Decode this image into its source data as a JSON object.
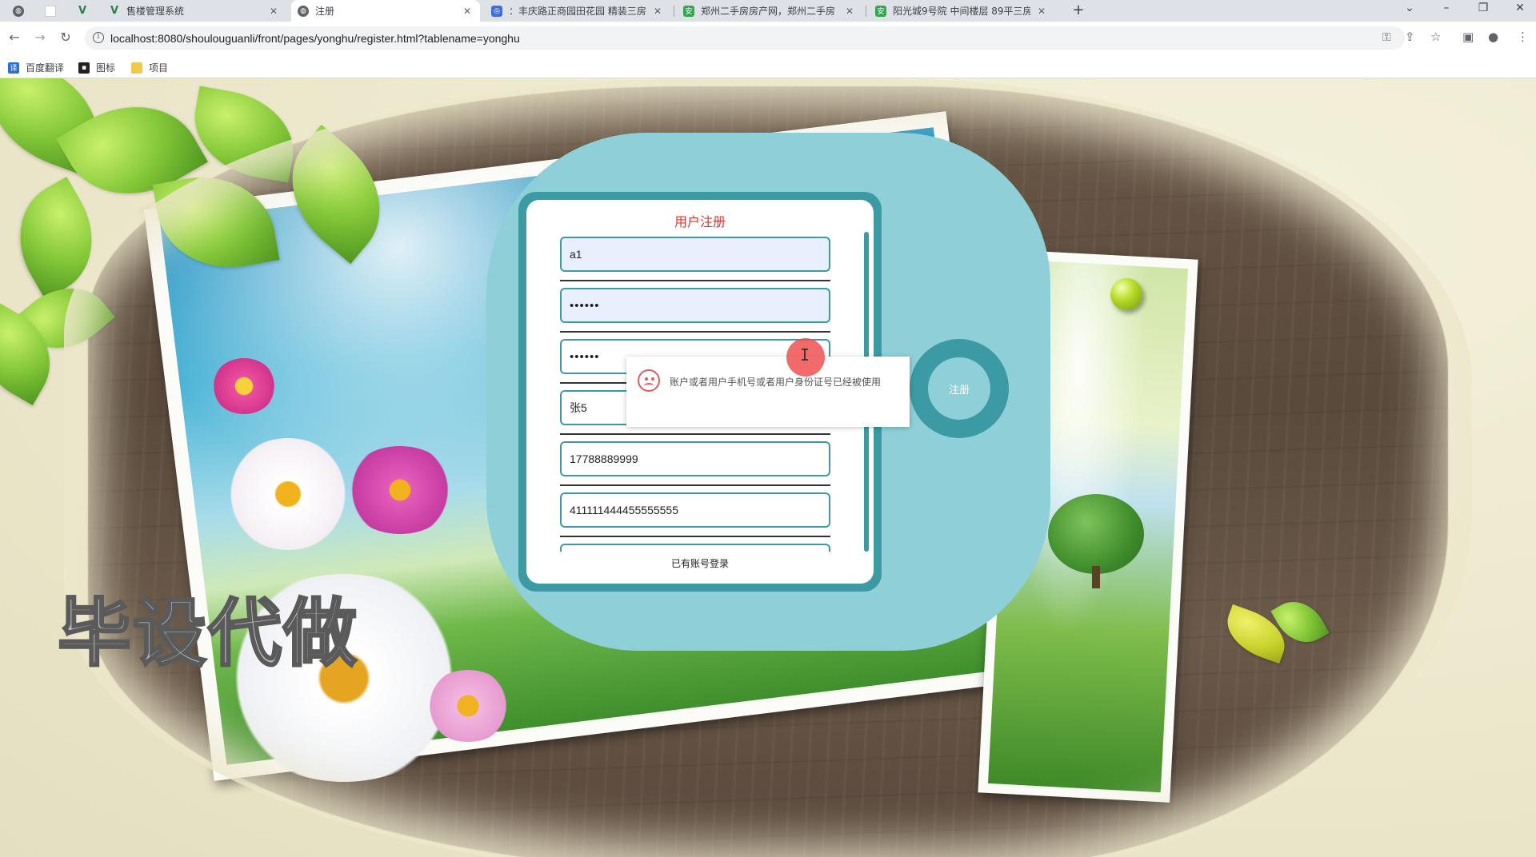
{
  "browser": {
    "tabs": [
      {
        "title": "",
        "icon": "globe-icon"
      },
      {
        "title": "",
        "icon": "blank-page-icon"
      },
      {
        "title": "",
        "icon": "vue-icon"
      },
      {
        "title": "售楼管理系统",
        "icon": "vue-icon"
      },
      {
        "title": "注册",
        "icon": "globe-icon",
        "active": true
      },
      {
        "title": "：丰庆路正商园田花园 精装三房",
        "icon": "baidu-icon"
      },
      {
        "title": "郑州二手房房产网，郑州二手房",
        "icon": "anjuke-icon"
      },
      {
        "title": "阳光城9号院 中间楼层 89平三房",
        "icon": "anjuke-icon"
      }
    ],
    "new_tab": "+",
    "url": "localhost:8080/shoulouguanli/front/pages/yonghu/register.html?tablename=yonghu",
    "bookmarks": [
      {
        "label": "百度翻译",
        "icon": "translate-icon",
        "color": "#2b6fd6"
      },
      {
        "label": "图标",
        "icon": "image-icon",
        "color": "#222222"
      },
      {
        "label": "项目",
        "icon": "folder-icon",
        "color": "#f2c84b"
      }
    ]
  },
  "register": {
    "title": "用户注册",
    "fields": [
      {
        "name": "account-field",
        "value": "a1",
        "autofill": true,
        "masked": false
      },
      {
        "name": "password-field",
        "value": "••••••",
        "autofill": true,
        "masked": true
      },
      {
        "name": "confirm-password-field",
        "value": "••••••",
        "autofill": false,
        "masked": true
      },
      {
        "name": "name-field",
        "value": "张5",
        "autofill": false,
        "masked": false
      },
      {
        "name": "phone-field",
        "value": "17788889999",
        "autofill": false,
        "masked": false
      },
      {
        "name": "id-card-field",
        "value": "411111444455555555",
        "autofill": false,
        "masked": false
      }
    ],
    "login_link": "已有账号登录",
    "submit_label": "注册"
  },
  "toast": {
    "message": "账户或者用户手机号或者用户身份证号已经被使用",
    "icon": "sad-face-icon"
  },
  "watermark": "毕设代做",
  "colors": {
    "accent": "#3b9aa3",
    "blob": "#8ecfd8",
    "title_red": "#e2322c",
    "error_red": "#e05c5c"
  }
}
